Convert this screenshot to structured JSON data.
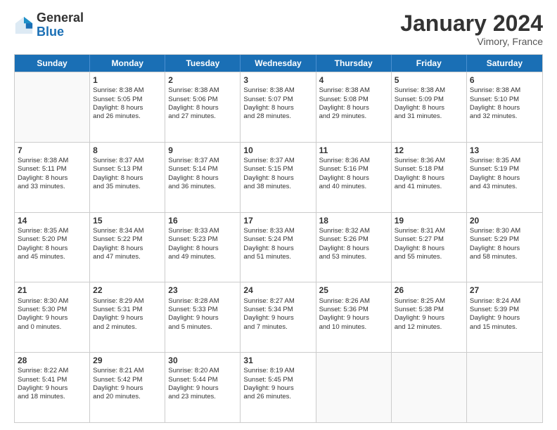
{
  "header": {
    "logo": {
      "line1": "General",
      "line2": "Blue"
    },
    "title": "January 2024",
    "location": "Vimory, France"
  },
  "weekdays": [
    "Sunday",
    "Monday",
    "Tuesday",
    "Wednesday",
    "Thursday",
    "Friday",
    "Saturday"
  ],
  "weeks": [
    [
      {
        "day": "",
        "content": ""
      },
      {
        "day": "1",
        "content": "Sunrise: 8:38 AM\nSunset: 5:05 PM\nDaylight: 8 hours\nand 26 minutes."
      },
      {
        "day": "2",
        "content": "Sunrise: 8:38 AM\nSunset: 5:06 PM\nDaylight: 8 hours\nand 27 minutes."
      },
      {
        "day": "3",
        "content": "Sunrise: 8:38 AM\nSunset: 5:07 PM\nDaylight: 8 hours\nand 28 minutes."
      },
      {
        "day": "4",
        "content": "Sunrise: 8:38 AM\nSunset: 5:08 PM\nDaylight: 8 hours\nand 29 minutes."
      },
      {
        "day": "5",
        "content": "Sunrise: 8:38 AM\nSunset: 5:09 PM\nDaylight: 8 hours\nand 31 minutes."
      },
      {
        "day": "6",
        "content": "Sunrise: 8:38 AM\nSunset: 5:10 PM\nDaylight: 8 hours\nand 32 minutes."
      }
    ],
    [
      {
        "day": "7",
        "content": "Sunrise: 8:38 AM\nSunset: 5:11 PM\nDaylight: 8 hours\nand 33 minutes."
      },
      {
        "day": "8",
        "content": "Sunrise: 8:37 AM\nSunset: 5:13 PM\nDaylight: 8 hours\nand 35 minutes."
      },
      {
        "day": "9",
        "content": "Sunrise: 8:37 AM\nSunset: 5:14 PM\nDaylight: 8 hours\nand 36 minutes."
      },
      {
        "day": "10",
        "content": "Sunrise: 8:37 AM\nSunset: 5:15 PM\nDaylight: 8 hours\nand 38 minutes."
      },
      {
        "day": "11",
        "content": "Sunrise: 8:36 AM\nSunset: 5:16 PM\nDaylight: 8 hours\nand 40 minutes."
      },
      {
        "day": "12",
        "content": "Sunrise: 8:36 AM\nSunset: 5:18 PM\nDaylight: 8 hours\nand 41 minutes."
      },
      {
        "day": "13",
        "content": "Sunrise: 8:35 AM\nSunset: 5:19 PM\nDaylight: 8 hours\nand 43 minutes."
      }
    ],
    [
      {
        "day": "14",
        "content": "Sunrise: 8:35 AM\nSunset: 5:20 PM\nDaylight: 8 hours\nand 45 minutes."
      },
      {
        "day": "15",
        "content": "Sunrise: 8:34 AM\nSunset: 5:22 PM\nDaylight: 8 hours\nand 47 minutes."
      },
      {
        "day": "16",
        "content": "Sunrise: 8:33 AM\nSunset: 5:23 PM\nDaylight: 8 hours\nand 49 minutes."
      },
      {
        "day": "17",
        "content": "Sunrise: 8:33 AM\nSunset: 5:24 PM\nDaylight: 8 hours\nand 51 minutes."
      },
      {
        "day": "18",
        "content": "Sunrise: 8:32 AM\nSunset: 5:26 PM\nDaylight: 8 hours\nand 53 minutes."
      },
      {
        "day": "19",
        "content": "Sunrise: 8:31 AM\nSunset: 5:27 PM\nDaylight: 8 hours\nand 55 minutes."
      },
      {
        "day": "20",
        "content": "Sunrise: 8:30 AM\nSunset: 5:29 PM\nDaylight: 8 hours\nand 58 minutes."
      }
    ],
    [
      {
        "day": "21",
        "content": "Sunrise: 8:30 AM\nSunset: 5:30 PM\nDaylight: 9 hours\nand 0 minutes."
      },
      {
        "day": "22",
        "content": "Sunrise: 8:29 AM\nSunset: 5:31 PM\nDaylight: 9 hours\nand 2 minutes."
      },
      {
        "day": "23",
        "content": "Sunrise: 8:28 AM\nSunset: 5:33 PM\nDaylight: 9 hours\nand 5 minutes."
      },
      {
        "day": "24",
        "content": "Sunrise: 8:27 AM\nSunset: 5:34 PM\nDaylight: 9 hours\nand 7 minutes."
      },
      {
        "day": "25",
        "content": "Sunrise: 8:26 AM\nSunset: 5:36 PM\nDaylight: 9 hours\nand 10 minutes."
      },
      {
        "day": "26",
        "content": "Sunrise: 8:25 AM\nSunset: 5:38 PM\nDaylight: 9 hours\nand 12 minutes."
      },
      {
        "day": "27",
        "content": "Sunrise: 8:24 AM\nSunset: 5:39 PM\nDaylight: 9 hours\nand 15 minutes."
      }
    ],
    [
      {
        "day": "28",
        "content": "Sunrise: 8:22 AM\nSunset: 5:41 PM\nDaylight: 9 hours\nand 18 minutes."
      },
      {
        "day": "29",
        "content": "Sunrise: 8:21 AM\nSunset: 5:42 PM\nDaylight: 9 hours\nand 20 minutes."
      },
      {
        "day": "30",
        "content": "Sunrise: 8:20 AM\nSunset: 5:44 PM\nDaylight: 9 hours\nand 23 minutes."
      },
      {
        "day": "31",
        "content": "Sunrise: 8:19 AM\nSunset: 5:45 PM\nDaylight: 9 hours\nand 26 minutes."
      },
      {
        "day": "",
        "content": ""
      },
      {
        "day": "",
        "content": ""
      },
      {
        "day": "",
        "content": ""
      }
    ]
  ]
}
